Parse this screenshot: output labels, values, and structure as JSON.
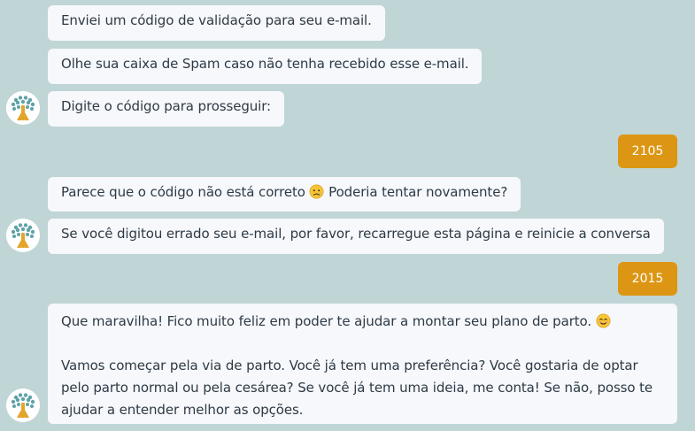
{
  "chat": {
    "bot_messages": [
      "Enviei um código de validação para seu e-mail.",
      "Olhe sua caixa de Spam caso não tenha recebido esse e-mail.",
      "Digite o código para prosseguir:",
      "Parece que o código não está correto",
      "Poderia tentar novamente?",
      "Se você digitou errado seu e-mail, por favor, recarregue esta página e reinicie a conversa"
    ],
    "user_messages": [
      "2105",
      "2015"
    ],
    "final_message": {
      "line1": "Que maravilha! Fico muito feliz em poder te ajudar a montar seu plano de parto.",
      "line2": "Vamos começar pela via de parto. Você já tem uma preferência? Você gostaria de optar",
      "line3": "pelo parto normal ou pela cesárea? Se você já tem uma ideia, me conta! Se não, posso te",
      "line4": "ajudar a entender melhor as opções."
    },
    "emojis": {
      "sad": "sad-face-emoji",
      "smile": "smiling-face-emoji"
    },
    "colors": {
      "background": "#c0d5d6",
      "bot_bubble": "#f7f8fc",
      "user_bubble": "#dc9613",
      "text": "#2d3a45"
    },
    "avatar_icon": "tree-logo-icon"
  }
}
